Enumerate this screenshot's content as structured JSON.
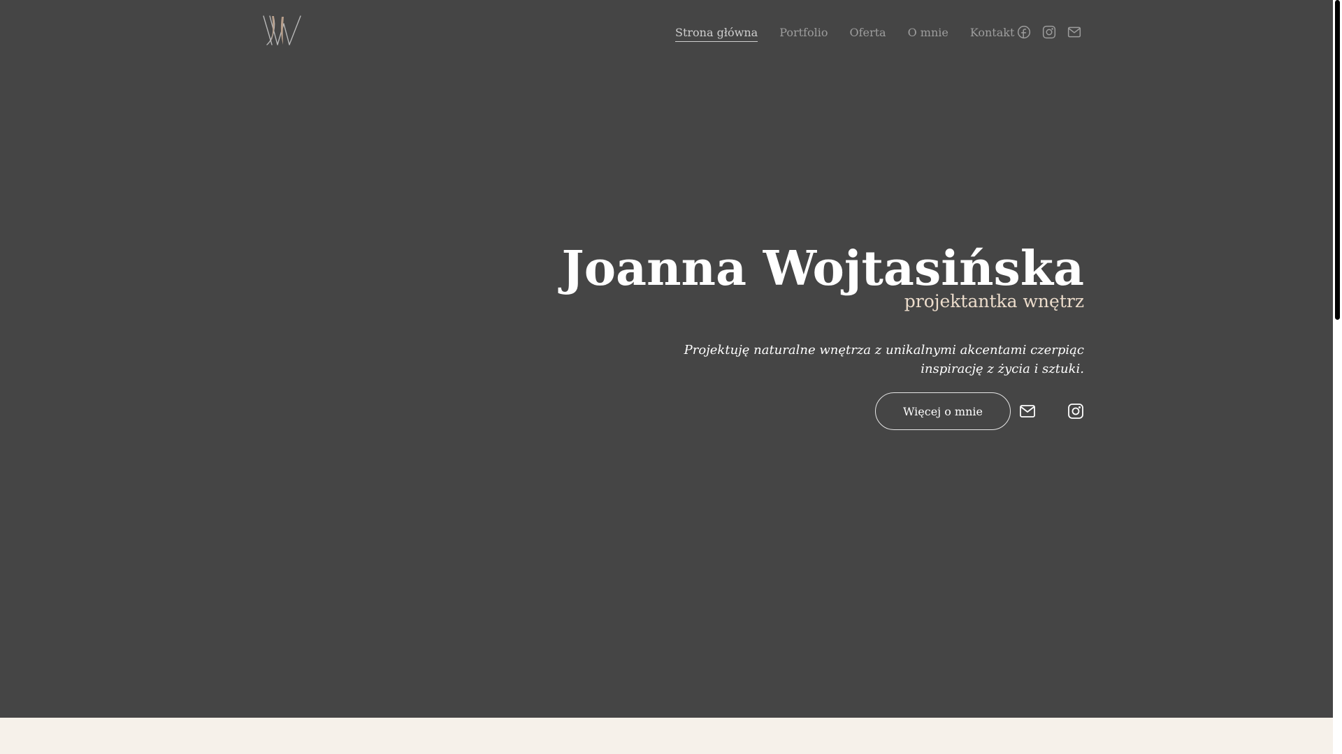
{
  "site": {
    "logo_text": "JW"
  },
  "nav": {
    "items": [
      {
        "label": "Strona główna",
        "active": true
      },
      {
        "label": "Portfolio"
      },
      {
        "label": "Oferta"
      },
      {
        "label": "O mnie"
      },
      {
        "label": "Kontakt"
      }
    ],
    "icons": [
      "facebook-icon",
      "instagram-icon",
      "mail-icon"
    ]
  },
  "hero": {
    "title": "Joanna Wojtasińska",
    "subtitle": "projektantka wnętrz",
    "description": "Projektuję naturalne wnętrza z unikalnymi akcentami czerpiąc  inspirację z życia i sztuki.",
    "cta_label": "Więcej o mnie",
    "cta_icons": [
      "mail-icon",
      "instagram-icon"
    ]
  },
  "colors": {
    "hero_background": "#454545",
    "accent": "#ecdccb",
    "page_background": "#f6f1ea",
    "nav_text": "#9d9d9d"
  }
}
